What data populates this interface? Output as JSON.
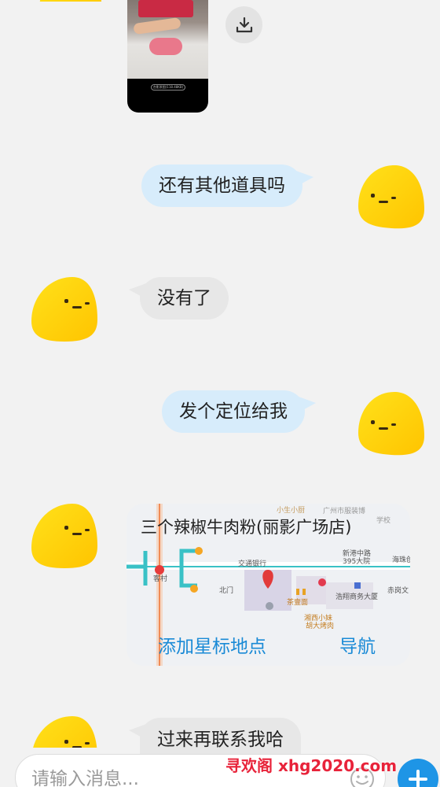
{
  "messages": [
    {
      "id": "m1",
      "text": "还有其他道具吗"
    },
    {
      "id": "m2",
      "text": "没有了"
    },
    {
      "id": "m3",
      "text": "发个定位给我"
    },
    {
      "id": "m5",
      "text": "过来再联系我哈"
    }
  ],
  "photo_message": {
    "caption": "合影原图(118.48KB)"
  },
  "location": {
    "name": "三个辣椒牛肉粉(丽影广场店)",
    "favorite_label": "添加星标地点",
    "navigate_label": "导航",
    "map_labels": {
      "bank": "交通银行",
      "village": "客村",
      "north_gate": "北门",
      "road1": "新港中路",
      "road1b": "395大院",
      "district": "海珠创",
      "snack": "小生小厨",
      "museum": "广州市服装博",
      "school": "学校",
      "tea": "茶壹面",
      "shop": "湘西小妹",
      "shop2": "胡大烤肉",
      "hotel": "浩翔商务大厦",
      "metro": "赤岗文"
    }
  },
  "composer": {
    "placeholder": "请输入消息..."
  },
  "watermark": "寻欢阁 xhg2020.com",
  "colors": {
    "accent": "#1e95e6",
    "bubble_out": "#d7ecfb",
    "bubble_in": "#e7e7e7",
    "avatar": "#ffd400",
    "watermark": "#e8233a"
  }
}
